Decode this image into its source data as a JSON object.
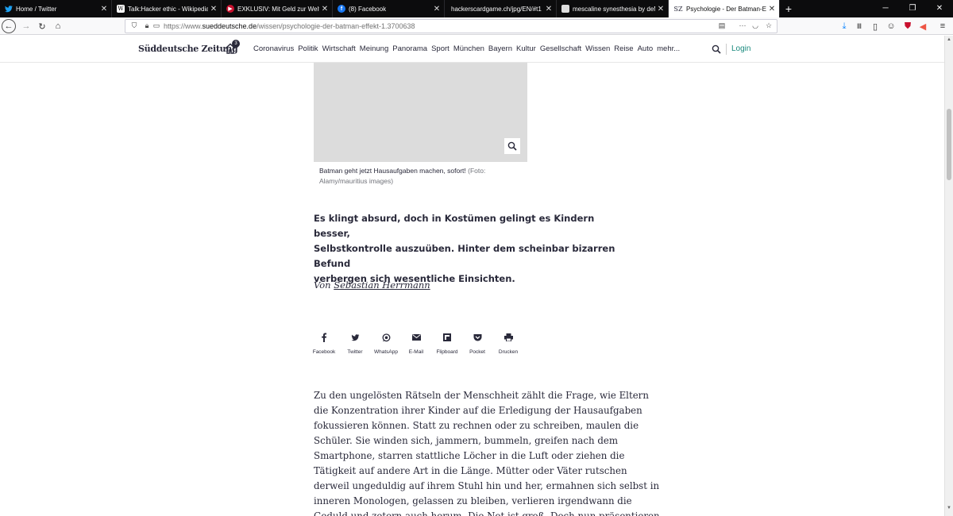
{
  "browser": {
    "tabs": [
      {
        "title": "Home / Twitter",
        "icon": "twitter-icon"
      },
      {
        "title": "Talk:Hacker ethic - Wikipedia",
        "icon": "wikipedia-icon"
      },
      {
        "title": "EXKLUSIV: Mit Geld zur Welthe",
        "icon": "news-icon"
      },
      {
        "title": "(8) Facebook",
        "icon": "facebook-icon"
      },
      {
        "title": "hackerscardgame.ch/jpg/EN/#t1",
        "icon": ""
      },
      {
        "title": "mescaline synesthesia by deMo",
        "icon": "page-icon"
      },
      {
        "title": "Psychologie - Der Batman-Effe",
        "icon": "sz-icon"
      }
    ],
    "url_prefix": "https://www.",
    "url_domain": "sueddeutsche.de",
    "url_path": "/wissen/psychologie-der-batman-effekt-1.3700638",
    "menu_badge": "8"
  },
  "site": {
    "logo": "Süddeutsche Zeitung",
    "home_badge": "3",
    "nav": [
      "Coronavirus",
      "Politik",
      "Wirtschaft",
      "Meinung",
      "Panorama",
      "Sport",
      "München",
      "Bayern",
      "Kultur",
      "Gesellschaft",
      "Wissen",
      "Reise",
      "Auto",
      "mehr..."
    ],
    "login": "Login"
  },
  "article": {
    "caption": "Batman geht jetzt Hausaufgaben machen, sofort!",
    "credit": "(Foto: Alamy/mauritius images)",
    "teaser_lines": [
      "Es klingt absurd, doch in Kostümen gelingt es Kindern besser,",
      "Selbstkontrolle auszuüben. Hinter dem scheinbar bizarren Befund",
      "verbergen sich wesentliche Einsichten."
    ],
    "author_prefix": "Von",
    "author_name": "Sebastian Herrmann",
    "share": [
      "Facebook",
      "Twitter",
      "WhatsApp",
      "E-Mail",
      "Flipboard",
      "Pocket",
      "Drucken"
    ],
    "body_lines": [
      "Zu den ungelösten Rätseln der Menschheit zählt die Frage, wie Eltern",
      "die Konzentration ihrer Kinder auf die Erledigung der Hausaufgaben",
      "fokussieren können. Statt zu rechnen oder zu schreiben, maulen die",
      "Schüler. Sie winden sich, jammern, bummeln, greifen nach dem",
      "Smartphone, starren stattliche Löcher in die Luft oder ziehen die",
      "Tätigkeit auf andere Art in die Länge. Mütter oder Väter rutschen",
      "derweil ungeduldig auf ihrem Stuhl hin und her, ermahnen sich selbst in",
      "inneren Monologen, gelassen zu bleiben, verlieren irgendwann die",
      "Geduld und zetern auch herum. Die Not ist groß. Doch nun präsentieren"
    ]
  }
}
